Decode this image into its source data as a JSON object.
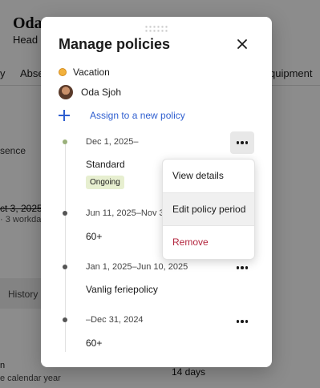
{
  "background": {
    "title": "Oda",
    "subtitle": "Head o",
    "tabs": [
      "y",
      "Abse",
      "quipment"
    ],
    "absence_label": "sence",
    "date_strikethrough": "ct 3, 2025",
    "workdays": "· 3 workday",
    "history_label": "History",
    "row_label": "n",
    "calendar_year": "e calendar year",
    "days": "14 days"
  },
  "modal": {
    "title": "Manage policies",
    "absence_type": "Vacation",
    "employee": "Oda Sjoh",
    "assign_label": "Assign to a new policy"
  },
  "periods": [
    {
      "date": "Dec 1, 2025–",
      "name": "Standard",
      "badge": "Ongoing"
    },
    {
      "date": "Jun 11, 2025–Nov 30,",
      "name": "60+"
    },
    {
      "date": "Jan 1, 2025–Jun 10, 2025",
      "name": "Vanlig feriepolicy"
    },
    {
      "date": "–Dec 31, 2024",
      "name": "60+"
    }
  ],
  "menu": {
    "items": [
      "View details",
      "Edit policy period",
      "Remove"
    ]
  },
  "colors": {
    "link": "#2f5fd0",
    "danger": "#b3263e",
    "badge_bg": "#e7efd0",
    "vacation_dot": "#f2b13d"
  }
}
